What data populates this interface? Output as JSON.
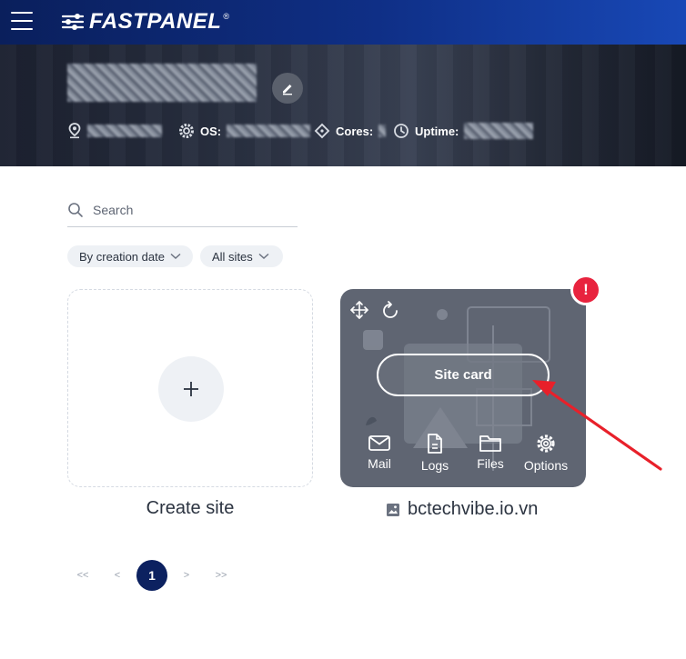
{
  "header": {
    "brand": "FASTPANEL",
    "reg_mark": "®"
  },
  "server": {
    "os_label": "OS:",
    "cores_label": "Cores:",
    "uptime_label": "Uptime:"
  },
  "search": {
    "placeholder": "Search",
    "value": ""
  },
  "filters": {
    "sort_label": "By creation date",
    "scope_label": "All sites"
  },
  "create": {
    "label": "Create site",
    "plus": "+"
  },
  "site": {
    "domain": "bctechvibe.io.vn",
    "card_button": "Site card",
    "alert": "!",
    "actions": [
      {
        "label": "Mail",
        "icon": "mail-icon"
      },
      {
        "label": "Logs",
        "icon": "logs-icon"
      },
      {
        "label": "Files",
        "icon": "folder-icon"
      },
      {
        "label": "Options",
        "icon": "gear-icon"
      }
    ]
  },
  "pagination": {
    "first": "<<",
    "prev": "<",
    "current": "1",
    "next": ">",
    "last": ">>"
  },
  "colors": {
    "accent": "#0c2160",
    "alert": "#e8233e",
    "annotation_arrow": "#e8202a"
  }
}
